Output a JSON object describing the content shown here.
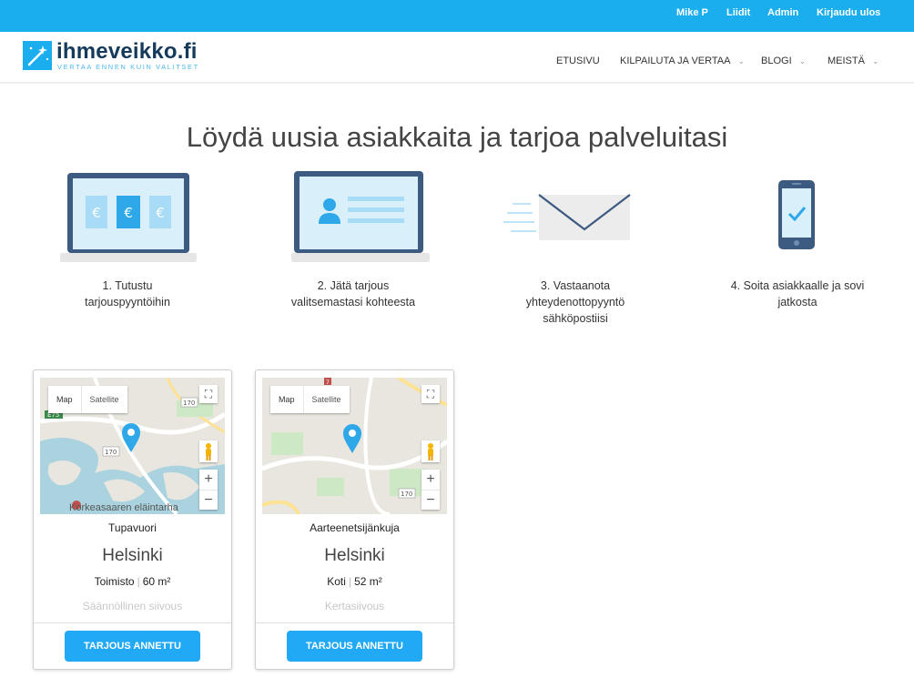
{
  "topbar": {
    "user": "Mike P",
    "leads": "Liidit",
    "admin": "Admin",
    "logout": "Kirjaudu ulos"
  },
  "header": {
    "logo_text": "ihmeveikko.fi",
    "logo_tagline": "VERTAA ENNEN KUIN VALITSET",
    "nav": [
      {
        "label": "ETUSIVU",
        "dropdown": false
      },
      {
        "label": "KILPAILUTA JA VERTAA",
        "dropdown": true
      },
      {
        "label": "BLOGI",
        "dropdown": true
      },
      {
        "label": "MEISTÄ",
        "dropdown": true
      }
    ]
  },
  "headline": "Löydä uusia asiakkaita ja tarjoa palveluitasi",
  "steps": [
    {
      "icon": "laptop-euro-icon",
      "line1": "1. Tutustu",
      "line2": "tarjouspyyntöihin",
      "line3": ""
    },
    {
      "icon": "laptop-profile-icon",
      "line1": "2. Jätä tarjous",
      "line2": "valitsemastasi kohteesta",
      "line3": ""
    },
    {
      "icon": "envelope-icon",
      "line1": "3. Vastaanota",
      "line2": "yhteydenottopyyntö",
      "line3": "sähköpostiisi"
    },
    {
      "icon": "phone-check-icon",
      "line1": "4. Soita asiakkaalle ja sovi",
      "line2": "jatkosta",
      "line3": ""
    }
  ],
  "map_ui": {
    "map_label": "Map",
    "satellite_label": "Satellite",
    "zoom_in": "+",
    "zoom_out": "−"
  },
  "cards": [
    {
      "street": "Tupavuori",
      "city": "Helsinki",
      "type": "Toimisto",
      "size": "60 m²",
      "cleaning": "Säännöllinen siivous",
      "button": "TARJOUS ANNETTU",
      "map_caption": "Korkeasaaren eläintarha",
      "road_labels": [
        "170",
        "170",
        "E75"
      ]
    },
    {
      "street": "Aarteenetsijänkuja",
      "city": "Helsinki",
      "type": "Koti",
      "size": "52 m²",
      "cleaning": "Kertasiivous",
      "button": "TARJOUS ANNETTU",
      "map_caption": "",
      "road_labels": [
        "170",
        "7"
      ]
    }
  ],
  "colors": {
    "accent": "#1aaeef",
    "button": "#22a9f5",
    "logo_dark": "#163a5a",
    "illustration_dark": "#3d5a80",
    "illustration_light": "#d9f0fb",
    "map_pin": "#2ea8e8"
  }
}
